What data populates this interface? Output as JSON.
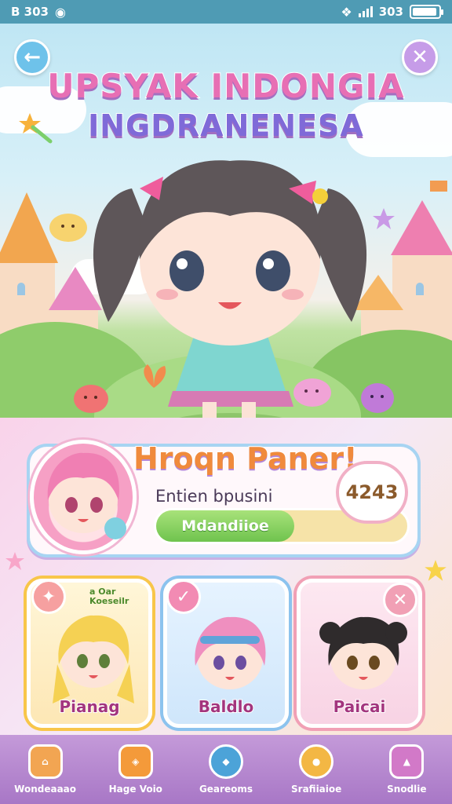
{
  "status_bar": {
    "left_text": "B 303",
    "right_text": "303",
    "battery_level": 0.95
  },
  "header": {
    "back_icon": "arrow-left-icon",
    "close_icon": "close-icon",
    "title_line1": "UPSYAK INDONGIA",
    "title_line2": "INGDRANENESA"
  },
  "profile": {
    "name": "Hroqn Paner!",
    "subtitle": "Entien bpusini",
    "progress_label": "Mdandiioe",
    "progress_fraction": 0.55,
    "score": "4243"
  },
  "characters": [
    {
      "name": "Pianag",
      "badge_text": "a Oar\nKoeseilr",
      "badge_icon": "bird-icon",
      "color": "#f8c64a"
    },
    {
      "name": "Baldlo",
      "badge_icon": "check-icon",
      "color": "#8cc3ee"
    },
    {
      "name": "Paicai",
      "badge_icon": "close-icon",
      "color": "#f1a0b5"
    }
  ],
  "nav": [
    {
      "label": "Wondeaaao",
      "icon": "house-icon"
    },
    {
      "label": "Hage Voio",
      "icon": "pot-icon"
    },
    {
      "label": "Geareoms",
      "icon": "gem-icon"
    },
    {
      "label": "Srafiiaioe",
      "icon": "egg-icon"
    },
    {
      "label": "Snodlie",
      "icon": "cake-icon"
    }
  ],
  "colors": {
    "status_bar": "#4f9bb4",
    "accent_pink": "#e76fb4",
    "accent_purple": "#a877c6"
  }
}
